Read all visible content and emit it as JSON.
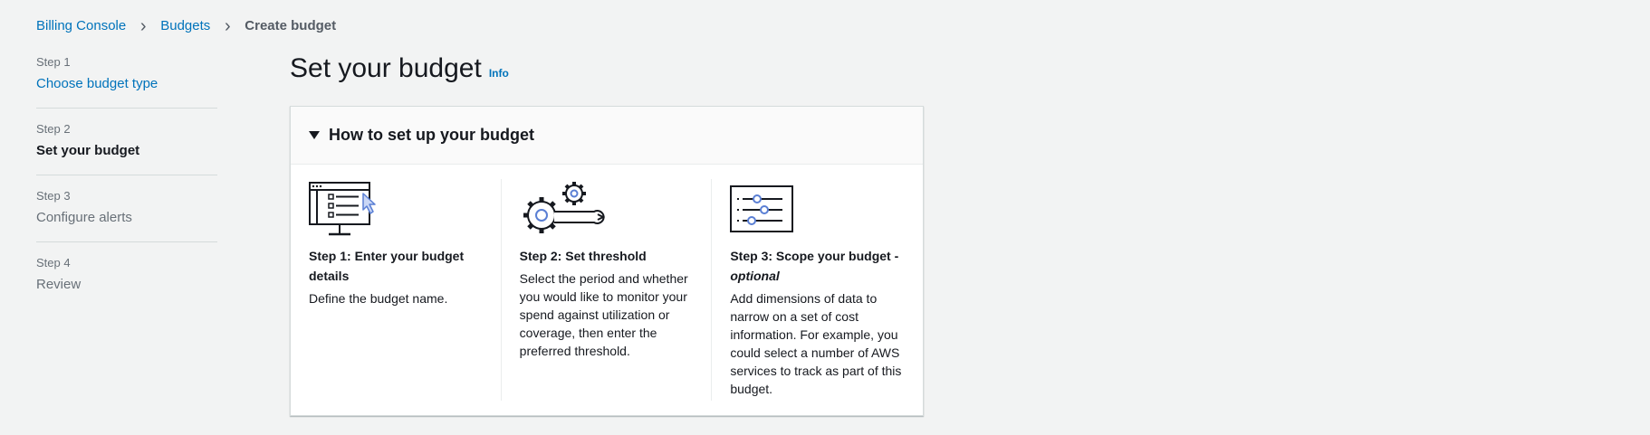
{
  "breadcrumb": {
    "items": [
      "Billing Console",
      "Budgets"
    ],
    "current": "Create budget"
  },
  "wizard": {
    "steps": [
      {
        "number": "Step 1",
        "title": "Choose budget type",
        "state": "done"
      },
      {
        "number": "Step 2",
        "title": "Set your budget",
        "state": "active"
      },
      {
        "number": "Step 3",
        "title": "Configure alerts",
        "state": "pending"
      },
      {
        "number": "Step 4",
        "title": "Review",
        "state": "pending"
      }
    ]
  },
  "main": {
    "title": "Set your budget",
    "info_link": "Info",
    "panel": {
      "title": "How to set up your budget",
      "expanded": true,
      "steps": [
        {
          "icon": "monitor-form-icon",
          "title": "Step 1: Enter your budget details",
          "title_suffix": "",
          "description": "Define the budget name."
        },
        {
          "icon": "gears-wrench-icon",
          "title": "Step 2: Set threshold",
          "title_suffix": "",
          "description": "Select the period and whether you would like to monitor your spend against utilization or coverage, then enter the preferred threshold."
        },
        {
          "icon": "sliders-filter-icon",
          "title": "Step 3: Scope your budget -",
          "title_suffix": "optional",
          "description": "Add dimensions of data to narrow on a set of cost information. For example, you could select a number of AWS services to track as part of this budget."
        }
      ]
    }
  },
  "colors": {
    "background": "#f2f3f3",
    "link": "#0073bb",
    "text": "#16191f",
    "muted": "#687078",
    "icon_accent": "#5a7fd4"
  }
}
